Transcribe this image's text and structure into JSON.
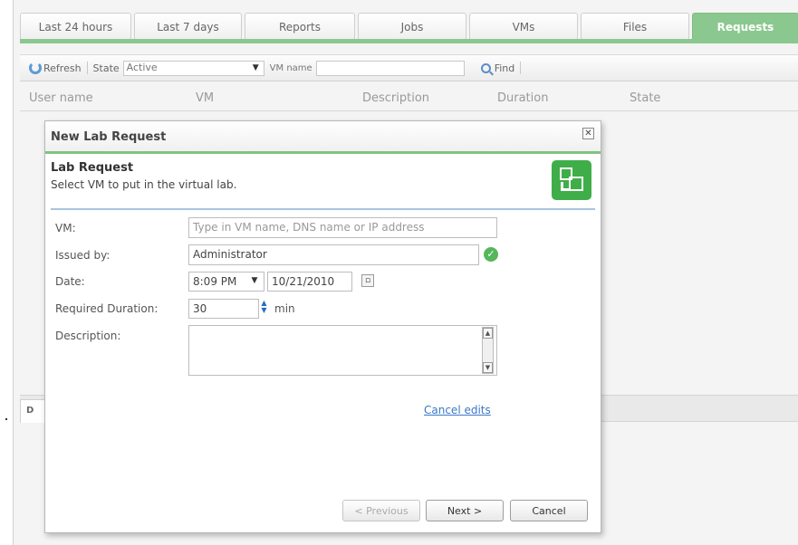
{
  "tabs": [
    "Last 24 hours",
    "Last 7 days",
    "Reports",
    "Jobs",
    "VMs",
    "Files",
    "Requests"
  ],
  "active_tab": "Requests",
  "toolbar": {
    "refresh_label": "Refresh",
    "state_label": "State",
    "state_value": "Active",
    "vm_name_label": "VM name",
    "vm_name_value": "",
    "find_label": "Find"
  },
  "grid": {
    "columns": [
      "User name",
      "VM",
      "Description",
      "Duration",
      "State"
    ]
  },
  "details_tab_label": "D",
  "dialog": {
    "title": "New Lab Request",
    "section_title": "Lab Request",
    "section_subtitle": "Select VM to put in the virtual lab.",
    "fields": {
      "vm_label": "VM:",
      "vm_placeholder": "Type in VM name, DNS name or IP address",
      "issued_by_label": "Issued by:",
      "issued_by_value": "Administrator",
      "date_label": "Date:",
      "time_value": "8:09 PM",
      "date_value": "10/21/2010",
      "duration_label": "Required Duration:",
      "duration_value": "30",
      "duration_unit": "min",
      "description_label": "Description:",
      "description_value": ""
    },
    "cancel_edits": "Cancel edits",
    "buttons": {
      "previous": "< Previous",
      "next": "Next >",
      "cancel": "Cancel"
    }
  },
  "colors": {
    "accent_green": "#8bc890",
    "link_blue": "#3b77c7"
  }
}
